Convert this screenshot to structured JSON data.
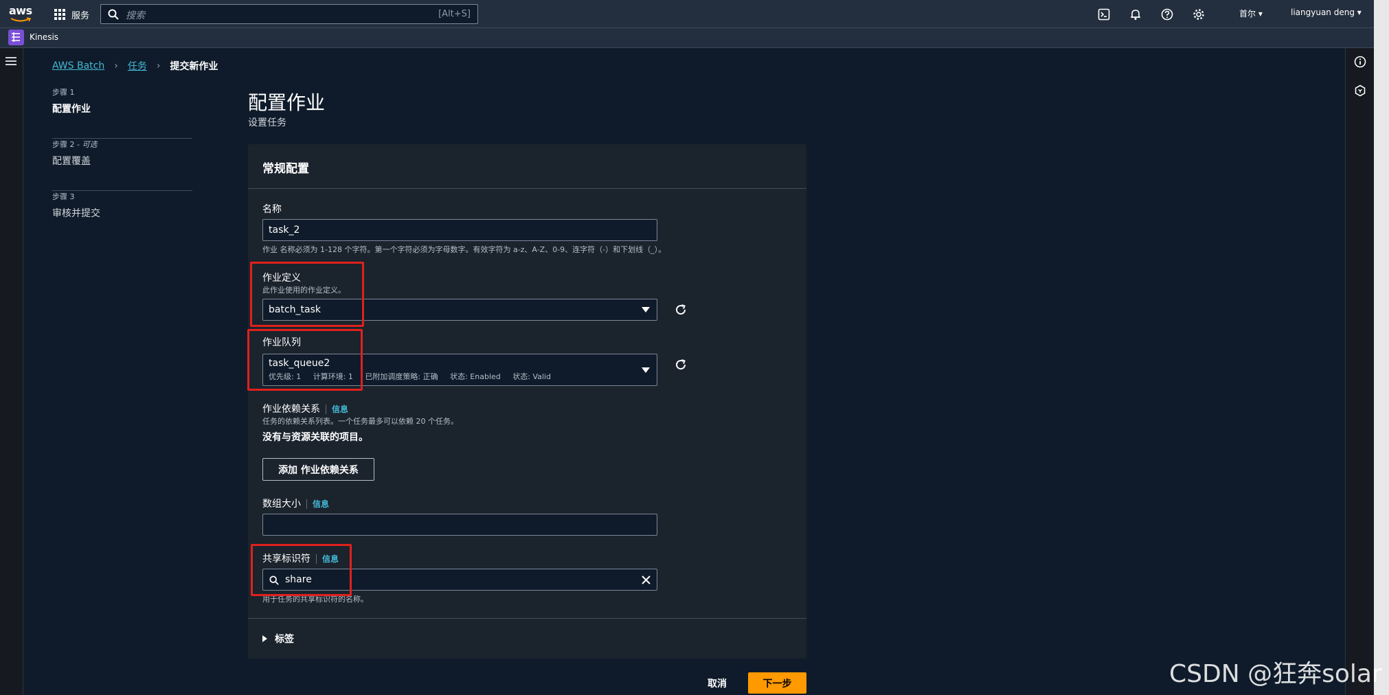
{
  "topnav": {
    "logo": "aws",
    "services_label": "服务",
    "search_placeholder": "搜索",
    "search_shortcut": "[Alt+S]",
    "region": "首尔",
    "user": "liangyuan deng"
  },
  "servicebar": {
    "service": "Kinesis"
  },
  "breadcrumb": {
    "items": [
      "AWS Batch",
      "任务",
      "提交新作业"
    ]
  },
  "steps": [
    {
      "num": "步骤 1",
      "optional": "",
      "name": "配置作业"
    },
    {
      "num": "步骤 2 - ",
      "optional": "可选",
      "name": "配置覆盖"
    },
    {
      "num": "步骤 3",
      "optional": "",
      "name": "审核并提交"
    }
  ],
  "page": {
    "title": "配置作业",
    "subtitle": "设置任务"
  },
  "panel": {
    "title": "常规配置",
    "name": {
      "label": "名称",
      "value": "task_2",
      "hint": "作业 名称必须为 1-128 个字符。第一个字符必须为字母数字。有效字符为 a-z、A-Z、0-9、连字符（-）和下划线（_）。"
    },
    "job_definition": {
      "label": "作业定义",
      "desc": "此作业使用的作业定义。",
      "value": "batch_task"
    },
    "job_queue": {
      "label": "作业队列",
      "value": "task_queue2",
      "meta": [
        "优先级: 1",
        "计算环境: 1",
        "已附加调度策略: 正确",
        "状态: Enabled",
        "状态: Valid"
      ]
    },
    "dependencies": {
      "label": "作业依赖关系",
      "info": "信息",
      "desc": "任务的依赖关系列表。一个任务最多可以依赖 20 个任务。",
      "empty": "没有与资源关联的项目。",
      "add_button": "添加 作业依赖关系"
    },
    "array_size": {
      "label": "数组大小",
      "info": "信息",
      "value": ""
    },
    "share_identifier": {
      "label": "共享标识符",
      "info": "信息",
      "value": "share",
      "hint": "用于任务的共享标识符的名称。"
    },
    "tags": {
      "label": "标签"
    }
  },
  "footer": {
    "cancel": "取消",
    "next": "下一步"
  },
  "watermark": "CSDN @狂奔solar",
  "colors": {
    "accent": "#ff9900",
    "link": "#44b9d6",
    "highlight": "#e0211d"
  }
}
